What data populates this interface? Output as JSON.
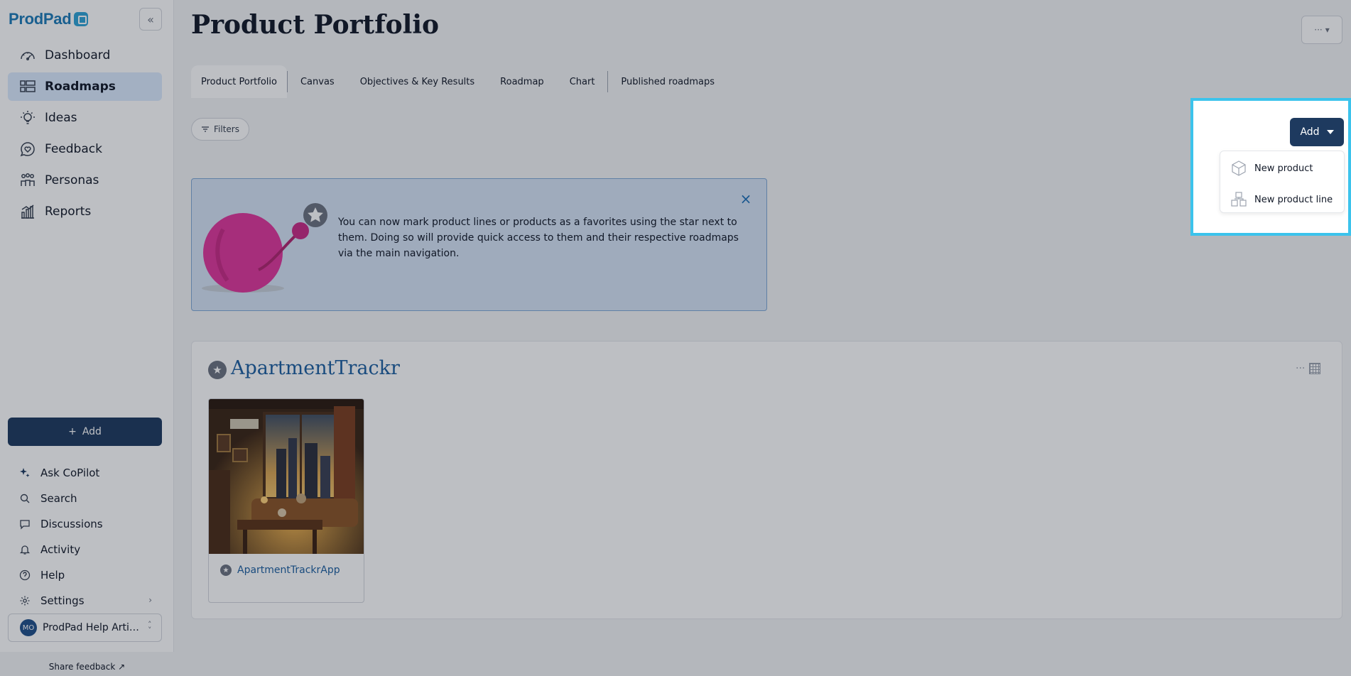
{
  "sidebar": {
    "logo_text": "ProdPad",
    "collapse_icon": "«",
    "nav": [
      {
        "label": "Dashboard",
        "icon": "dashboard-gauge-icon",
        "active": false
      },
      {
        "label": "Roadmaps",
        "icon": "roadmaps-grid-icon",
        "active": true
      },
      {
        "label": "Ideas",
        "icon": "lightbulb-icon",
        "active": false
      },
      {
        "label": "Feedback",
        "icon": "heart-chat-icon",
        "active": false
      },
      {
        "label": "Personas",
        "icon": "people-icon",
        "active": false
      },
      {
        "label": "Reports",
        "icon": "bar-chart-icon",
        "active": false
      }
    ],
    "add_label": "Add",
    "utilities": [
      {
        "label": "Ask CoPilot",
        "icon": "sparkle-icon"
      },
      {
        "label": "Search",
        "icon": "search-icon"
      },
      {
        "label": "Discussions",
        "icon": "chat-bubble-icon"
      },
      {
        "label": "Activity",
        "icon": "bell-icon"
      },
      {
        "label": "Help",
        "icon": "help-circle-icon"
      },
      {
        "label": "Settings",
        "icon": "gear-icon",
        "chevron": "›"
      }
    ],
    "account": {
      "initials": "MO",
      "label": "ProdPad Help Articl..."
    },
    "share_feedback": "Share feedback"
  },
  "header": {
    "title": "Product Portfolio",
    "more_label": "···"
  },
  "tabs": [
    {
      "label": "Product Portfolio",
      "active": true
    },
    {
      "label": "Canvas",
      "active": false
    },
    {
      "label": "Objectives & Key Results",
      "active": false
    },
    {
      "label": "Roadmap",
      "active": false
    },
    {
      "label": "Chart",
      "active": false
    },
    {
      "label": "Published roadmaps",
      "active": false
    }
  ],
  "filters_label": "Filters",
  "banner": {
    "text": "You can now mark product lines or products as a favorites using the star next to them. Doing so will provide quick access to them and their respective roadmaps via the main navigation.",
    "close_icon": "×"
  },
  "product_line": {
    "title": "ApartmentTrackr",
    "more_label": "···",
    "products": [
      {
        "name": "ApartmentTrackrApp"
      }
    ]
  },
  "add_menu": {
    "button_label": "Add",
    "items": [
      {
        "label": "New product",
        "icon": "product-box-icon"
      },
      {
        "label": "New product line",
        "icon": "product-line-icon"
      }
    ]
  },
  "colors": {
    "accent": "#1e3a5f",
    "link": "#1d5fa0",
    "highlight": "#3bc3ec",
    "banner_bg": "#d6e4f5"
  }
}
